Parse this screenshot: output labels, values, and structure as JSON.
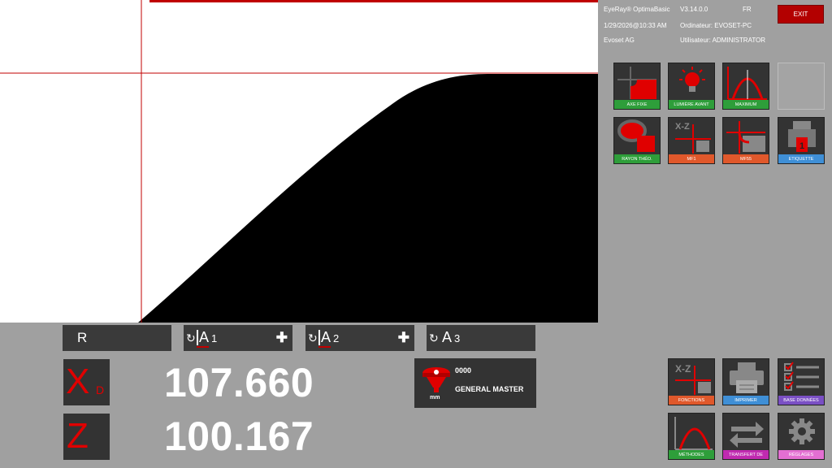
{
  "header": {
    "app_name": "EyeRay® OptimaBasic",
    "version": "V3.14.0.0",
    "language": "FR",
    "datetime": "1/29/2026@10:33 AM",
    "computer": "Ordinateur: EVOSET-PC",
    "company": "Evoset AG",
    "user": "Utilisateur: ADMINISTRATOR",
    "exit_label": "EXIT"
  },
  "tools": [
    {
      "label": "AXE FIXE",
      "icon": "fixed-axis-icon",
      "color": "#2e9e3a"
    },
    {
      "label": "LUMIÈRE AVANT",
      "icon": "front-light-icon",
      "color": "#2e9e3a"
    },
    {
      "label": "MAXIMUM",
      "icon": "maximum-icon",
      "color": "#2e9e3a"
    },
    {
      "label": "RAYON THÉO.",
      "icon": "theoretical-radius-icon",
      "color": "#2e9e3a"
    },
    {
      "label": "MF1",
      "icon": "mf1-icon",
      "color": "#e0582b"
    },
    {
      "label": "MF55",
      "icon": "mf55-icon",
      "color": "#e0582b"
    },
    {
      "label": "ETIQUETTE",
      "icon": "label-printer-icon",
      "color": "#3f8fd6"
    }
  ],
  "tabs": {
    "r": "R",
    "a1_letter": "A",
    "a1_num": "1",
    "a2_letter": "A",
    "a2_num": "2",
    "a3_letter": "A",
    "a3_num": "3"
  },
  "axes": {
    "x": {
      "letter": "X",
      "sub": "D",
      "value": "107.660"
    },
    "z": {
      "letter": "Z",
      "value": "100.167"
    }
  },
  "master": {
    "code": "0000",
    "name": "GENERAL MASTER",
    "unit": "mm"
  },
  "functions": [
    {
      "label": "FONCTIONS",
      "icon": "functions-icon",
      "color": "#e0582b"
    },
    {
      "label": "IMPRIMER",
      "icon": "printer-icon",
      "color": "#3f8fd6"
    },
    {
      "label": "BASE DONNÉES",
      "icon": "database-checklist-icon",
      "color": "#7a4fc4"
    },
    {
      "label": "MÉTHODES",
      "icon": "methods-icon",
      "color": "#2e9e3a"
    },
    {
      "label": "TRANSFERT DE",
      "icon": "transfer-icon",
      "color": "#c02ab0"
    },
    {
      "label": "RÉGLAGES",
      "icon": "gear-icon",
      "color": "#e36fd2"
    }
  ],
  "colors": {
    "accent": "#e00000",
    "panel": "#333333",
    "background": "#a0a0a0"
  }
}
